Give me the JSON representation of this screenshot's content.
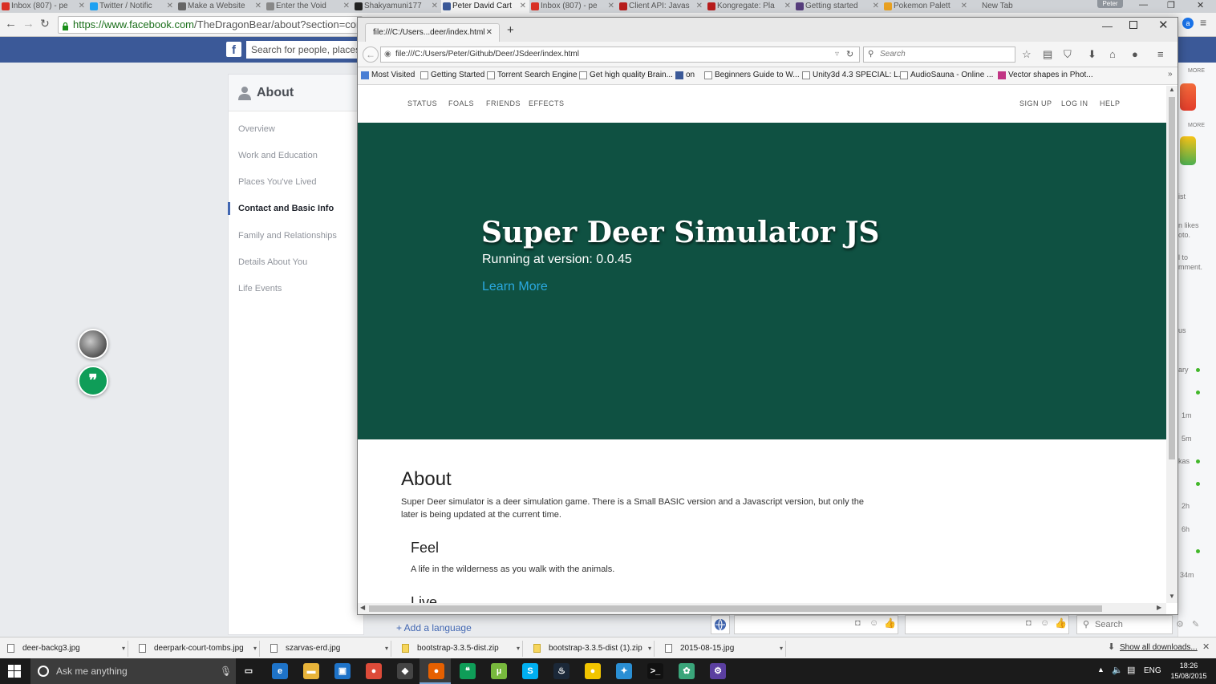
{
  "chrome": {
    "tabs": [
      {
        "label": "Inbox (807) - pe",
        "color": "#d93025",
        "active": false
      },
      {
        "label": "Twitter / Notific",
        "color": "#1da1f2",
        "active": false
      },
      {
        "label": "Make a Website",
        "color": "#666666",
        "active": false
      },
      {
        "label": "Enter the Void",
        "color": "#888888",
        "active": false
      },
      {
        "label": "Shakyamuni177",
        "color": "#222222",
        "active": false
      },
      {
        "label": "Peter David Cart",
        "color": "#3b5998",
        "active": true
      },
      {
        "label": "Inbox (807) - pe",
        "color": "#d93025",
        "active": false
      },
      {
        "label": "Client API: Javas",
        "color": "#b71c1c",
        "active": false
      },
      {
        "label": "Kongregate: Pla",
        "color": "#b71c1c",
        "active": false
      },
      {
        "label": "Getting started",
        "color": "#563d7c",
        "active": false
      },
      {
        "label": "Pokemon Palett",
        "color": "#e8a020",
        "active": false
      },
      {
        "label": "New Tab",
        "color": "#cfd2d6",
        "active": false
      }
    ],
    "profile": "Peter",
    "url_secure": "https://www.facebook.com",
    "url_rest": "/TheDragonBear/about?section=con"
  },
  "facebook": {
    "logo": "f",
    "search_placeholder": "Search for people, places",
    "about_title": "About",
    "nav": [
      {
        "label": "Overview",
        "active": false
      },
      {
        "label": "Work and Education",
        "active": false
      },
      {
        "label": "Places You've Lived",
        "active": false
      },
      {
        "label": "Contact and Basic Info",
        "active": true
      },
      {
        "label": "Family and Relationships",
        "active": false
      },
      {
        "label": "Details About You",
        "active": false
      },
      {
        "label": "Life Events",
        "active": false
      }
    ],
    "right_texts": [
      "MORE",
      "MORE",
      "ist",
      "n likes",
      "oto.",
      "l to",
      "mment.",
      "ary",
      "1m",
      "5m",
      "kas",
      "2h",
      "6h",
      "34m",
      "us"
    ],
    "add_language": "+ Add a language",
    "chat_search": "Search"
  },
  "firefox": {
    "tab_label": "file:///C:/Users...deer/index.html",
    "url": "file:///C:/Users/Peter/Github/Deer/JSdeer/index.html",
    "search_placeholder": "Search",
    "bookmarks": [
      "Most Visited",
      "Getting Started",
      "Torrent Search Engine",
      "Get high quality Brain...",
      "on",
      "Beginners Guide to W...",
      "Unity3d 4.3 SPECIAL: L...",
      "AudioSauna - Online ...",
      "Vector shapes in Phot..."
    ]
  },
  "site": {
    "nav_left": [
      "STATUS",
      "FOALS",
      "FRIENDS",
      "EFFECTS"
    ],
    "nav_right": [
      "SIGN UP",
      "LOG IN",
      "HELP"
    ],
    "hero_title": "Super Deer Simulator JS",
    "version_text": "Running at version: 0.0.45",
    "learn_more": "Learn More",
    "about_heading": "About",
    "about_text": "Super Deer simulator is a deer simulation game. There is a Small BASIC version and a Javascript version, but only the later is being updated at the current time.",
    "feel_heading": "Feel",
    "feel_text": "A life in the wilderness as you walk with the animals.",
    "live_heading": "Live",
    "hero_color": "#0f5142",
    "link_color": "#2aa9e0"
  },
  "downloads": {
    "items": [
      {
        "name": "deer-backg3.jpg",
        "type": "jpg"
      },
      {
        "name": "deerpark-court-tombs.jpg",
        "type": "jpg"
      },
      {
        "name": "szarvas-erd.jpg",
        "type": "jpg"
      },
      {
        "name": "bootstrap-3.3.5-dist.zip",
        "type": "zip"
      },
      {
        "name": "bootstrap-3.3.5-dist (1).zip",
        "type": "zip"
      },
      {
        "name": "2015-08-15.jpg",
        "type": "jpg"
      }
    ],
    "show_all": "Show all downloads..."
  },
  "taskbar": {
    "search_placeholder": "Ask me anything",
    "lang": "ENG",
    "time": "18:26",
    "date": "15/08/2015",
    "apps": [
      {
        "name": "task-view",
        "color": "#1b1b1b",
        "glyph": "▭"
      },
      {
        "name": "edge",
        "color": "#1e73c8",
        "glyph": "e"
      },
      {
        "name": "file-explorer",
        "color": "#e8b43a",
        "glyph": "▬"
      },
      {
        "name": "store",
        "color": "#1e73c8",
        "glyph": "▣"
      },
      {
        "name": "chrome",
        "color": "#dd4b39",
        "glyph": "●"
      },
      {
        "name": "app-dark",
        "color": "#444444",
        "glyph": "◆"
      },
      {
        "name": "firefox",
        "color": "#e66000",
        "glyph": "●"
      },
      {
        "name": "hangouts",
        "color": "#0f9d58",
        "glyph": "❝"
      },
      {
        "name": "utorrent",
        "color": "#78b93d",
        "glyph": "µ"
      },
      {
        "name": "skype",
        "color": "#00aff0",
        "glyph": "S"
      },
      {
        "name": "steam",
        "color": "#1b2838",
        "glyph": "♨"
      },
      {
        "name": "app-yellow",
        "color": "#f2c500",
        "glyph": "●"
      },
      {
        "name": "app-color",
        "color": "#2a8fd4",
        "glyph": "✦"
      },
      {
        "name": "cmd",
        "color": "#111111",
        "glyph": ">_"
      },
      {
        "name": "app-green",
        "color": "#3aa57a",
        "glyph": "✿"
      },
      {
        "name": "app-settings",
        "color": "#5b3fa0",
        "glyph": "⚙"
      }
    ]
  }
}
